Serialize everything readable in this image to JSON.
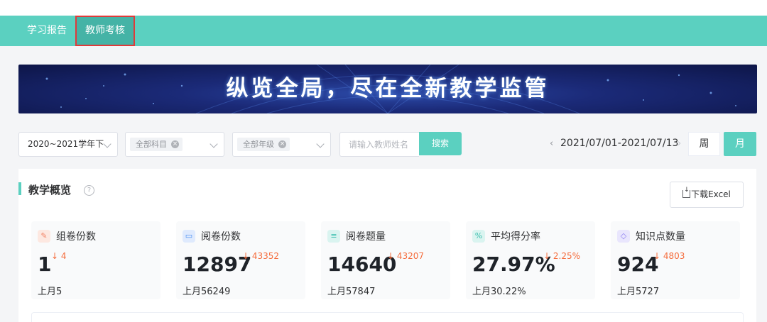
{
  "nav": {
    "tabs": [
      {
        "label": "学习报告"
      },
      {
        "label": "教师考核"
      }
    ]
  },
  "banner": {
    "text": "纵览全局，尽在全新教学监管"
  },
  "filters": {
    "term": "2020~2021学年下",
    "subject_tag": "全部科目",
    "grade_tag": "全部年级",
    "teacher_placeholder": "请输入教师姓名",
    "search_label": "搜索",
    "date_range": "2021/07/01-2021/07/13",
    "week_label": "周",
    "month_label": "月"
  },
  "overview": {
    "title": "教学概览",
    "download_label": "下载Excel",
    "cards": [
      {
        "label": "组卷份数",
        "value": "1",
        "change": "4",
        "prev": "上月5",
        "icon": "compose-icon",
        "color": "#f2866a",
        "bg": "#fde8e1"
      },
      {
        "label": "阅卷份数",
        "value": "12897",
        "change": "43352",
        "prev": "上月56249",
        "icon": "card-icon",
        "color": "#4a8ff0",
        "bg": "#dfeafd"
      },
      {
        "label": "阅卷题量",
        "value": "14640",
        "change": "43207",
        "prev": "上月57847",
        "icon": "document-icon",
        "color": "#3dbfae",
        "bg": "#daf4f0"
      },
      {
        "label": "平均得分率",
        "value": "27.97%",
        "change": "2.25%",
        "prev": "上月30.22%",
        "icon": "percent-icon",
        "color": "#3dbfae",
        "bg": "#daf4f0"
      },
      {
        "label": "知识点数量",
        "value": "924",
        "change": "4803",
        "prev": "上月5727",
        "icon": "bulb-icon",
        "color": "#8a7cf0",
        "bg": "#e9e6fd"
      }
    ]
  }
}
